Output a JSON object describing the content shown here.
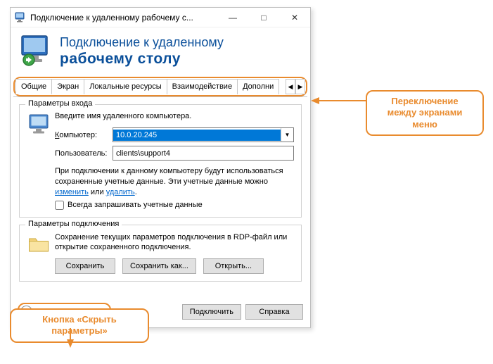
{
  "titlebar": {
    "title": "Подключение к удаленному рабочему с..."
  },
  "banner": {
    "line1": "Подключение к удаленному",
    "line2": "рабочему столу"
  },
  "tabs": {
    "items": [
      "Общие",
      "Экран",
      "Локальные ресурсы",
      "Взаимодействие",
      "Дополни"
    ],
    "active": 0
  },
  "login_group": {
    "title": "Параметры входа",
    "intro": "Введите имя удаленного компьютера.",
    "computer_label": "Компьютер:",
    "computer_value": "10.0.20.245",
    "user_label": "Пользователь:",
    "user_value": "clients\\support4",
    "saved_creds_prefix": "При подключении к данному компьютеру будут использоваться сохраненные учетные данные.  Эти учетные данные можно ",
    "edit_link": "изменить",
    "or_text": " или ",
    "delete_link": "удалить",
    "period": ".",
    "always_ask": "Всегда запрашивать учетные данные"
  },
  "conn_group": {
    "title": "Параметры подключения",
    "desc": "Сохранение текущих параметров подключения в RDP-файл или открытие сохраненного подключения.",
    "save": "Сохранить",
    "save_as": "Сохранить как...",
    "open": "Открыть..."
  },
  "footer": {
    "collapse": "Скрыть параметры",
    "connect": "Подключить",
    "help": "Справка"
  },
  "callouts": {
    "tabs": "Переключение между экранами меню",
    "collapse": "Кнопка «Скрыть параметры»"
  }
}
